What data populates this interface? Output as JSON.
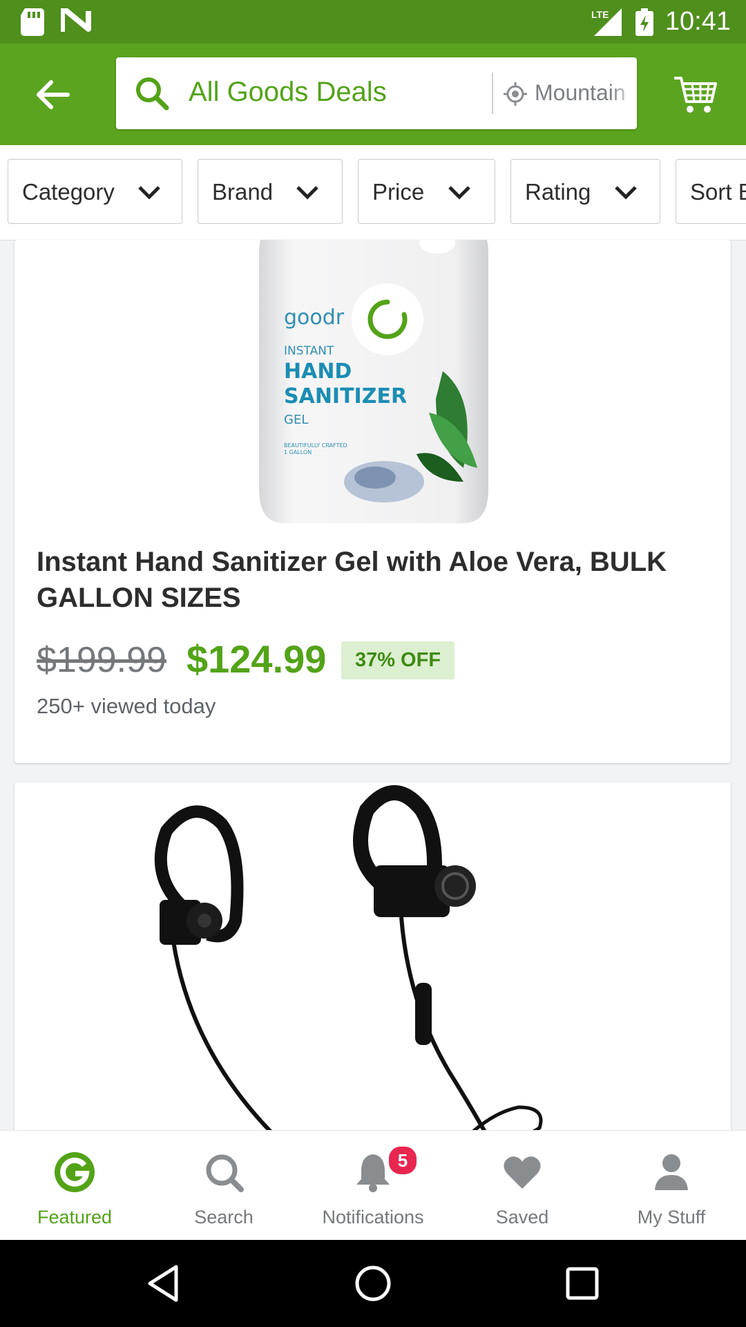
{
  "status_bar": {
    "time": "10:41",
    "network": "LTE"
  },
  "app_bar": {
    "search_text": "All Goods Deals",
    "location_text": "Mountain View"
  },
  "filters": [
    {
      "label": "Category"
    },
    {
      "label": "Brand"
    },
    {
      "label": "Price"
    },
    {
      "label": "Rating"
    },
    {
      "label": "Sort By"
    }
  ],
  "products": [
    {
      "title": "Instant Hand Sanitizer Gel with Aloe Vera, BULK GALLON SIZES",
      "original_price": "$199.99",
      "price": "$124.99",
      "discount": "37% OFF",
      "viewed": "250+ viewed today",
      "image_label": {
        "brand": "goodr",
        "line1": "INSTANT",
        "line2": "HAND",
        "line3": "SANITIZER",
        "line4": "GEL",
        "small1": "BEAUTIFULLY CRAFTED",
        "small2": "1 GALLON"
      }
    }
  ],
  "bottom_nav": {
    "tabs": [
      {
        "label": "Featured",
        "icon": "groupon-g-icon",
        "active": true
      },
      {
        "label": "Search",
        "icon": "search-icon"
      },
      {
        "label": "Notifications",
        "icon": "bell-icon",
        "badge": "5"
      },
      {
        "label": "Saved",
        "icon": "heart-icon"
      },
      {
        "label": "My Stuff",
        "icon": "person-icon"
      }
    ]
  },
  "colors": {
    "brand_green": "#53a318",
    "statusbar_green": "#4f8f1c",
    "appbar_green": "#5ba41f",
    "badge_red": "#e8264f"
  }
}
